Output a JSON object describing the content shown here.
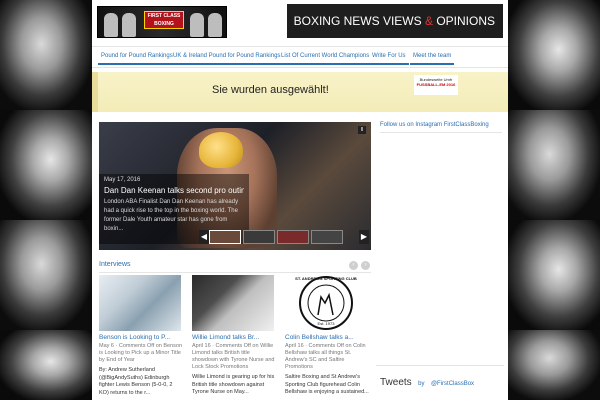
{
  "header": {
    "logo_badge": "FIRST CLASS BOXING",
    "banner": {
      "part1": "BOXING NEWS  VIEWS ",
      "amp": "&",
      "part2": " OPINIONS"
    }
  },
  "nav": {
    "items": [
      "Pound for Pound Rankings",
      "UK & Ireland Pound for Pound Rankings",
      "List Of Current World Champions",
      "Write For Us",
      "Meet the team"
    ]
  },
  "ad": {
    "text": "Sie wurden ausgewählt!",
    "brand_line1": "Bundesweite Umfr",
    "brand_line2": "FUSSBALL-EM 2016"
  },
  "slider": {
    "date": "May 17, 2016",
    "title": "Dan Dan Keenan talks second pro outing a...",
    "excerpt": "London ABA Finalist Dan Dan Keenan has already had a quick rise to the top in the boxing world. The former Dale Youth amateur star has gone from boxin...",
    "prev": "◀",
    "next": "▶",
    "pause": "II"
  },
  "sidebar": {
    "instagram_title": "Follow us on Instagram FirstClassBoxing"
  },
  "interviews": {
    "title": "Interviews",
    "prev": "‹",
    "next": "›",
    "cards": [
      {
        "title": "Benson is Looking to P...",
        "meta": "May 6  ·  Comments Off on Benson is Looking to Pick up a Minor Title by End of Year",
        "body": "By: Andrew Sutherland (@BigAndySuths) Edinburgh fighter Lewis Benson (5-0-0, 2 KO) returns to the r..."
      },
      {
        "title": "Willie Limond talks Br...",
        "meta": "April 16  ·  Comments Off on Willie Limond talks British title showdown with Tyrone Nurse and Lock Stock Promotions",
        "body": "Willie Limond is gearing up for his British title showdown against Tyrone Nurse on May..."
      },
      {
        "title": "Colin Bellshaw talks a...",
        "meta": "April 16  ·  Comments Off on Colin Bellshaw talks all things St. Andrew's SC and Saltire Promotions",
        "body": "Saltire Boxing and St Andrew's Sporting Club figurehead Colin Bellshaw is enjoying a sustained..."
      }
    ]
  },
  "club_logo": {
    "top": "ST. ANDREWS SPORTING CLUB",
    "est": "Est. 1973"
  },
  "tweets": {
    "label": "Tweets",
    "by": "by",
    "handle": "@FirstClassBox"
  },
  "colors": {
    "link": "#2a6fb0",
    "accent_red": "#e63030",
    "ad_bg": "#f3ecb8"
  }
}
